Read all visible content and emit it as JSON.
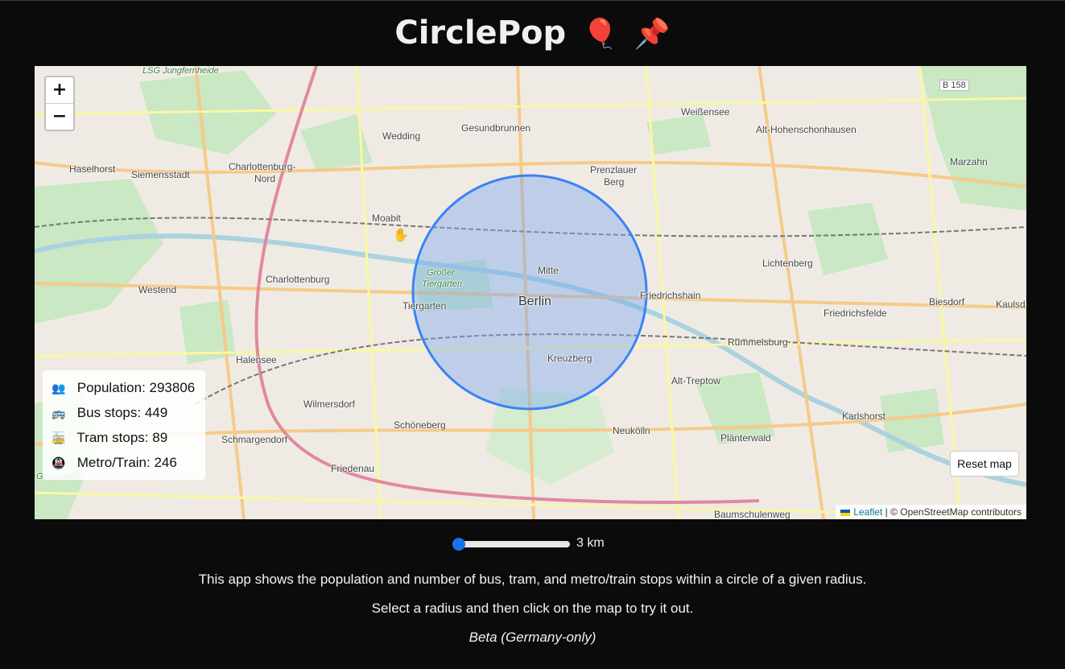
{
  "app": {
    "title": "CirclePop",
    "title_emojis": [
      "🎈",
      "📌"
    ]
  },
  "map": {
    "zoom_in_label": "+",
    "zoom_out_label": "−",
    "reset_label": "Reset map",
    "attribution": {
      "leaflet_label": "Leaflet",
      "separator": " | ",
      "osm_label": "© OpenStreetMap contributors"
    },
    "labels": {
      "berlin": "Berlin",
      "mitte": "Mitte",
      "moabit": "Moabit",
      "wedding": "Wedding",
      "gesundbrunnen": "Gesundbrunnen",
      "prenzlauer": "Prenzlauer",
      "berg": "Berg",
      "weissensee": "Weißensee",
      "alt_hohenschonhausen": "Alt-Hohenschonhausen",
      "marzahn": "Marzahn",
      "lichtenberg": "Lichtenberg",
      "friedrichshain": "Friedrichshain",
      "biesdorf": "Biesdorf",
      "kaulsd": "Kaulsd",
      "friedrichsfelde": "Friedrichsfelde",
      "rummelsburg": "Rummelsburg",
      "alt_treptow": "Alt-Treptow",
      "karlshorst": "Karlshorst",
      "planterwald": "Plänterwald",
      "baumschulenweg": "Baumschulenweg",
      "neukolln": "Neukölln",
      "kreuzberg": "Kreuzberg",
      "tiergarten": "Tiergarten",
      "grosser": "Großer",
      "tiergarten_park": "Tiergarten",
      "charlottenburg": "Charlottenburg",
      "charlottenburg_nord_1": "Charlottenburg-",
      "charlottenburg_nord_2": "Nord",
      "siemensstadt": "Siemensstadt",
      "haselhorst": "Haselhorst",
      "westend": "Westend",
      "halensee": "Halensee",
      "wilmersdorf": "Wilmersdorf",
      "schoneberg": "Schöneberg",
      "schmargendorf": "Schmargendorf",
      "friedenau": "Friedenau",
      "grunewald": "Grunewald",
      "lsg": "LSG Jungfernheide",
      "b158": "B 158"
    }
  },
  "stats": {
    "population": {
      "icon": "👥",
      "text": "Population: 293806"
    },
    "bus": {
      "icon": "🚌",
      "text": "Bus stops: 449"
    },
    "tram": {
      "icon": "🚋",
      "text": "Tram stops: 89"
    },
    "metro": {
      "icon": "🚇",
      "text": "Metro/Train: 246"
    }
  },
  "radius": {
    "value_label": "3 km",
    "fraction": 0.0
  },
  "description": {
    "line1": "This app shows the population and number of bus, tram, and metro/train stops within a circle of a given radius.",
    "line2": "Select a radius and then click on the map to try it out.",
    "line3": "Beta (Germany-only)"
  },
  "colors": {
    "circle_stroke": "#3b82f6",
    "circle_fill": "#7aa7f0",
    "accent": "#1a73e8"
  }
}
